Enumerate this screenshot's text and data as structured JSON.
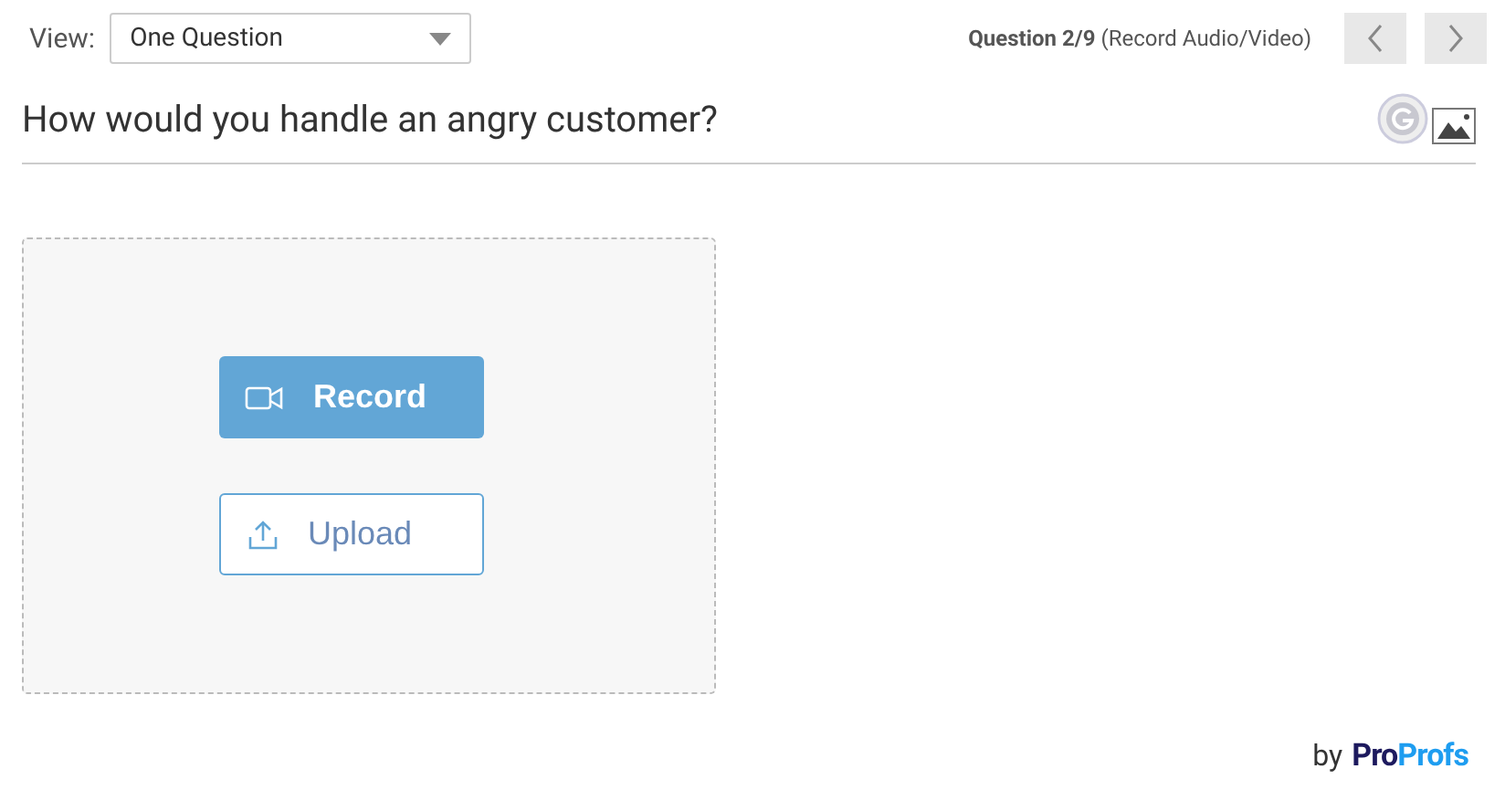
{
  "view": {
    "label": "View:",
    "value": "One Question"
  },
  "question_nav": {
    "number": "Question 2/9",
    "type": "(Record Audio/Video)"
  },
  "question": {
    "text": "How would you handle an angry customer?"
  },
  "answer_area": {
    "buttons": [
      {
        "kind": "record",
        "label": "Record"
      },
      {
        "kind": "upload",
        "label": "Upload"
      }
    ]
  },
  "footer": {
    "prefix": "by",
    "brand_parts": [
      "Pro",
      "Profs"
    ]
  }
}
